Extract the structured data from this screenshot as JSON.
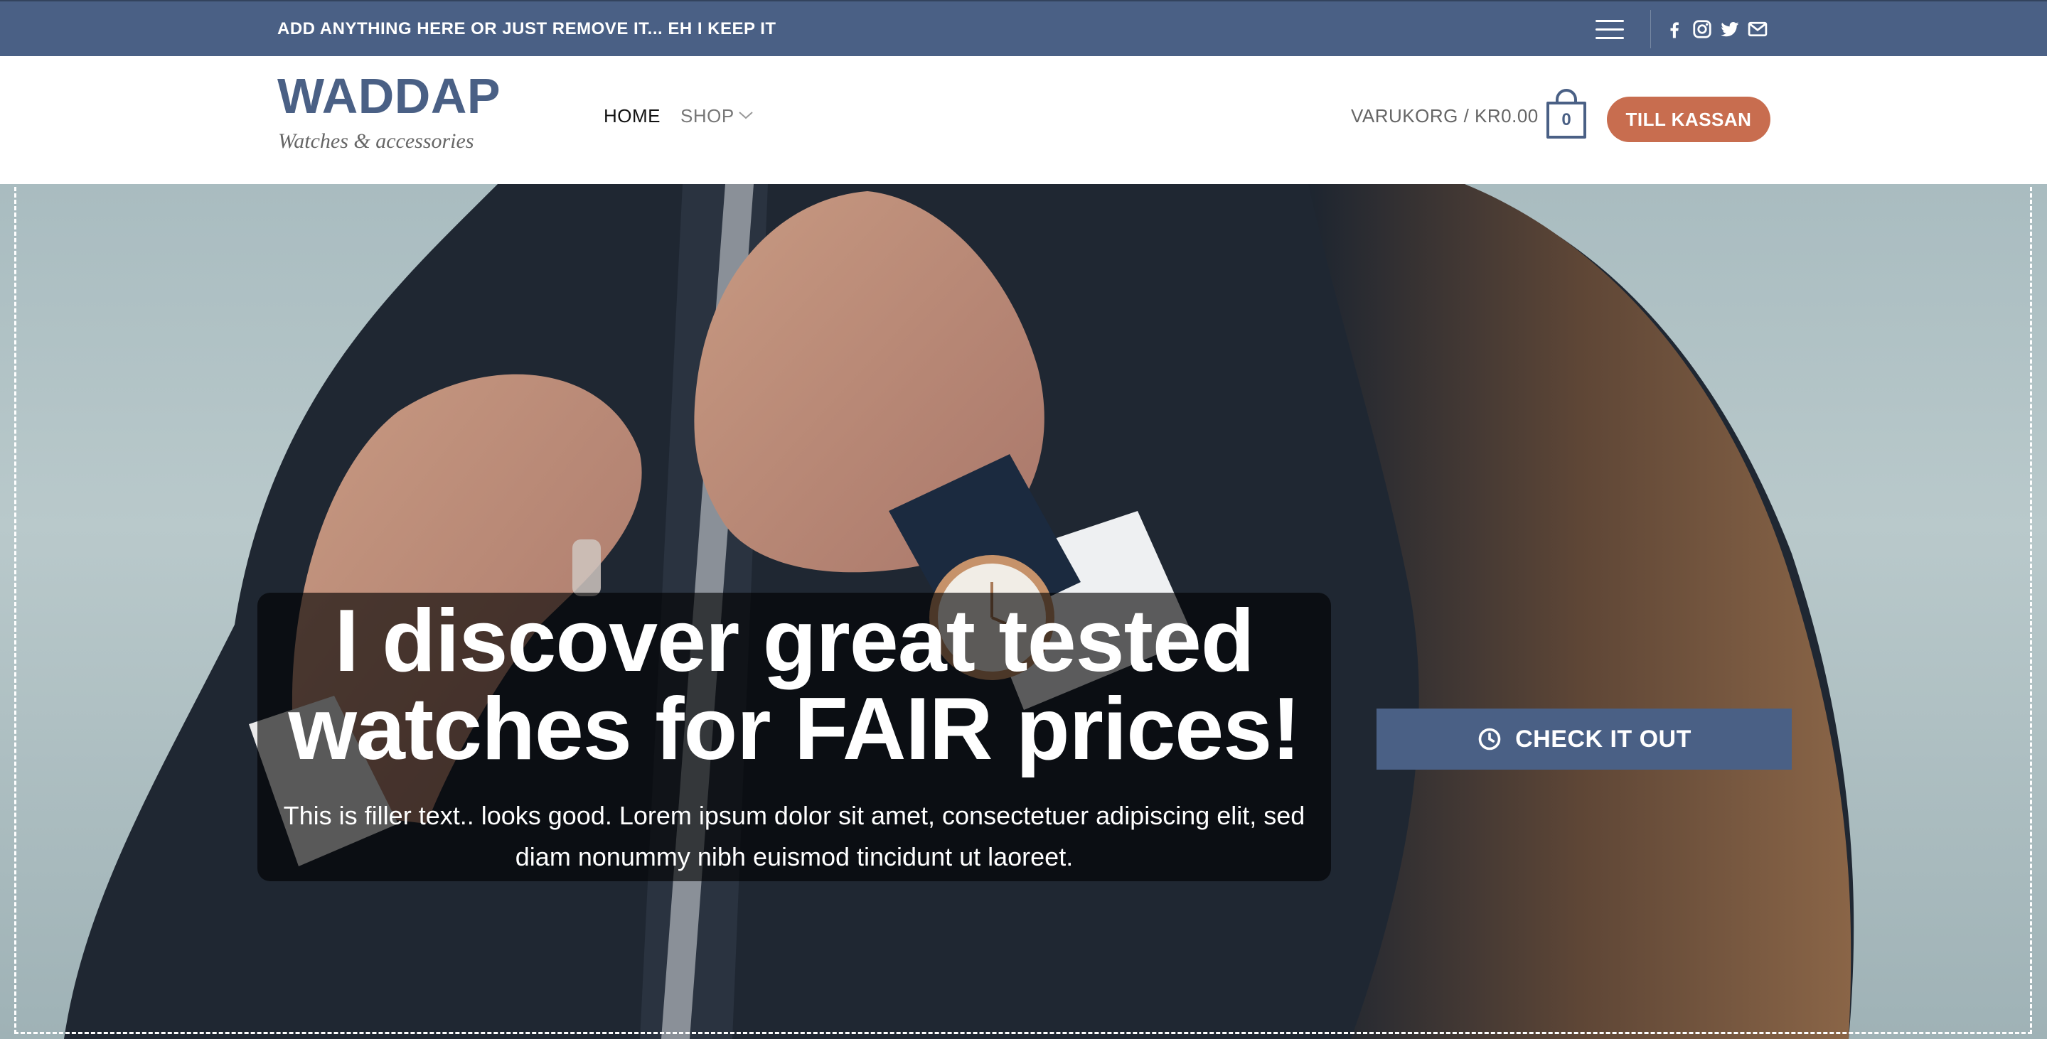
{
  "topbar": {
    "text": "ADD ANYTHING HERE OR JUST REMOVE IT... EH I KEEP IT",
    "social_icons": [
      "facebook-icon",
      "instagram-icon",
      "twitter-icon",
      "email-icon"
    ]
  },
  "header": {
    "logo_title": "WADDAP",
    "logo_tagline": "Watches & accessories",
    "nav": [
      {
        "label": "HOME",
        "active": true
      },
      {
        "label": "SHOP",
        "has_dropdown": true
      }
    ],
    "cart_label": "VARUKORG / KR0.00",
    "cart_count": "0",
    "checkout_label": "TILL KASSAN"
  },
  "hero": {
    "title_line1": "I discover great tested",
    "title_line2": "watches for FAIR prices!",
    "subtitle": "This is filler text.. looks good. Lorem ipsum dolor sit amet, consectetuer adipiscing elit, sed diam nonummy nibh euismod tincidunt ut laoreet.",
    "cta_label": "CHECK IT OUT",
    "cta_icon": "clock-icon"
  },
  "colors": {
    "primary": "#4a6085",
    "accent": "#c86d4f",
    "topbar_text": "#ffffff",
    "nav_muted": "#777777"
  }
}
